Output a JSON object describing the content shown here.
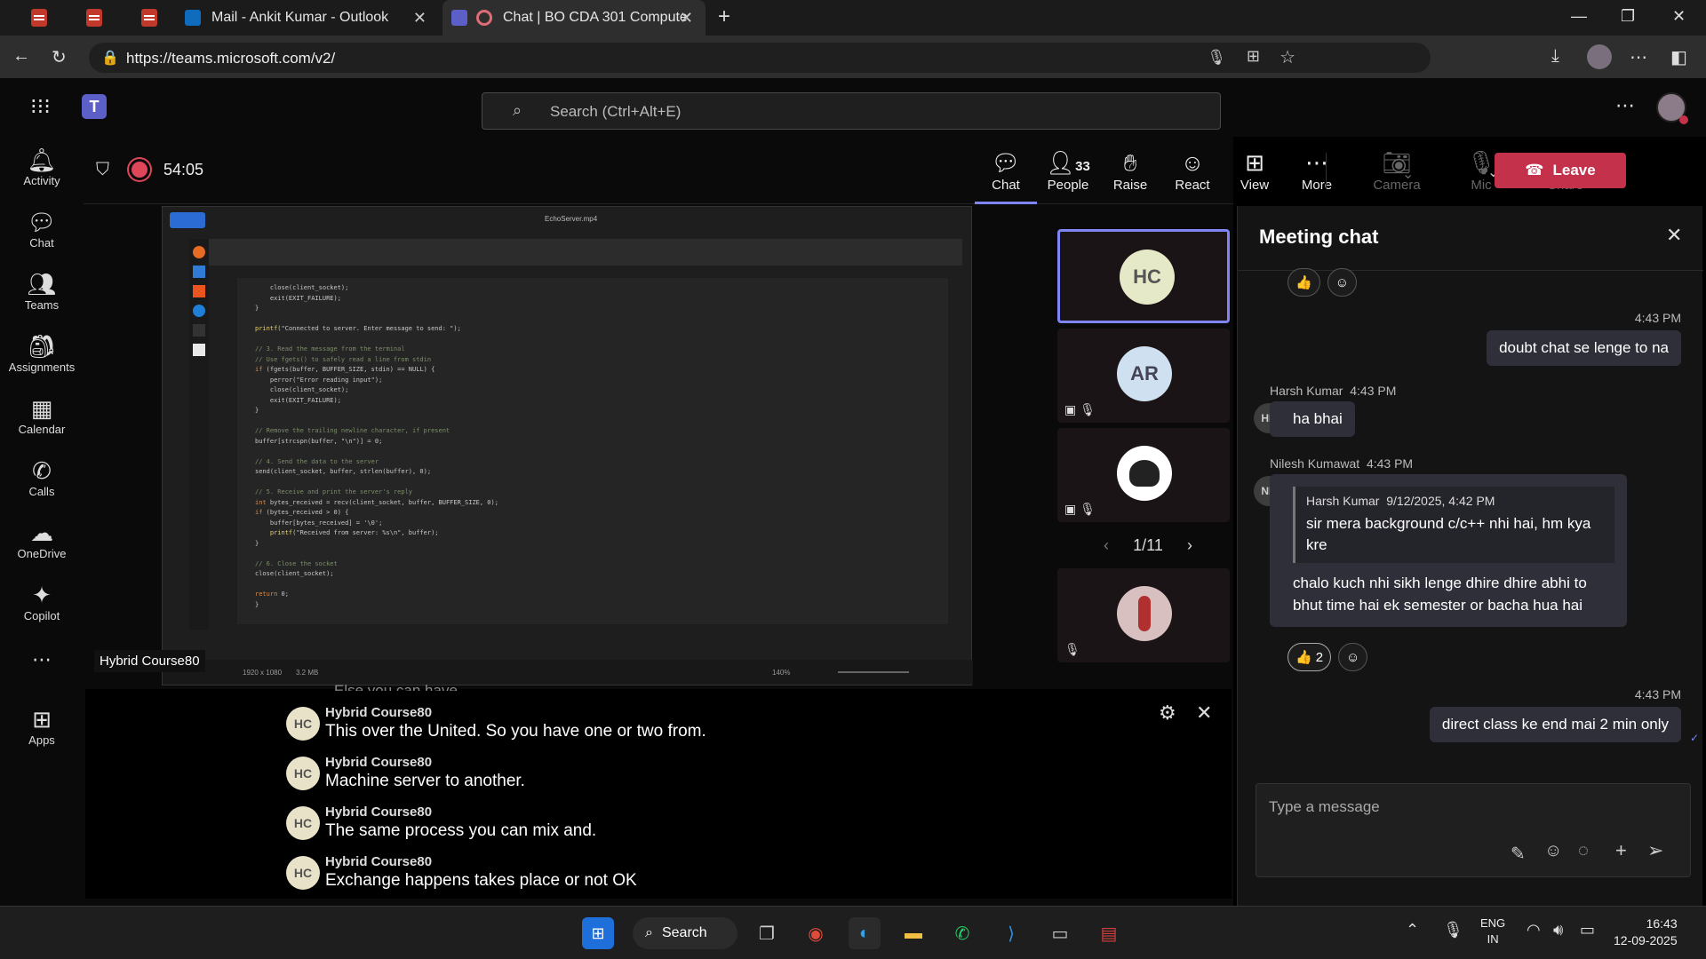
{
  "browser": {
    "tabs": [
      {
        "label": "Mail - Ankit Kumar - Outlook"
      },
      {
        "label": "Chat | BO CDA 301 Compute"
      }
    ],
    "url": "https://teams.microsoft.com/v2/"
  },
  "teams": {
    "search_placeholder": "Search (Ctrl+Alt+E)",
    "rail": [
      {
        "label": "Activity",
        "icon": "bell-icon"
      },
      {
        "label": "Chat",
        "icon": "chat-icon"
      },
      {
        "label": "Teams",
        "icon": "teams-icon"
      },
      {
        "label": "Assignments",
        "icon": "backpack-icon"
      },
      {
        "label": "Calendar",
        "icon": "calendar-icon"
      },
      {
        "label": "Calls",
        "icon": "phone-icon"
      },
      {
        "label": "OneDrive",
        "icon": "cloud-icon"
      },
      {
        "label": "Copilot",
        "icon": "copilot-icon"
      },
      {
        "label": "Apps",
        "icon": "apps-icon"
      }
    ]
  },
  "meeting": {
    "timer": "54:05",
    "controls": {
      "chat": "Chat",
      "people": "People",
      "people_count": "33",
      "raise": "Raise",
      "react": "React",
      "view": "View",
      "more": "More",
      "camera": "Camera",
      "mic": "Mic",
      "share": "Share",
      "leave": "Leave"
    },
    "shared_screen": {
      "filename": "EchoServer.mp4",
      "presenter_label": "Hybrid Course80",
      "zoom": "140%",
      "resolution": "1920 x 1080",
      "size": "3.2 MB"
    },
    "participants": [
      {
        "initials": "HC",
        "color": "#e6e9c8",
        "text_color": "#555"
      },
      {
        "initials": "AR",
        "color": "#cfe0f0",
        "text_color": "#445"
      },
      {
        "initials": "",
        "color": "#ffffff",
        "text_color": "#000"
      },
      {
        "initials": "",
        "color": "#d8c0c0",
        "text_color": "#000"
      }
    ],
    "pager": "1/11",
    "captions": [
      {
        "speaker": "Hybrid Course80",
        "initials": "HC",
        "text": "This over the United. So you have one or two from."
      },
      {
        "speaker": "Hybrid Course80",
        "initials": "HC",
        "text": "Machine server to another."
      },
      {
        "speaker": "Hybrid Course80",
        "initials": "HC",
        "text": "The same process you can mix and."
      },
      {
        "speaker": "Hybrid Course80",
        "initials": "HC",
        "text": "Exchange happens takes place or not OK"
      }
    ],
    "caption_partial": "Else you can have."
  },
  "chat": {
    "title": "Meeting chat",
    "messages": [
      {
        "time": "4:43 PM",
        "text": "doubt chat se lenge to na"
      },
      {
        "author": "Harsh Kumar",
        "initials": "HK",
        "time": "4:43 PM",
        "text": "ha bhai"
      },
      {
        "author": "Nilesh Kumawat",
        "initials": "NK",
        "time": "4:43 PM",
        "quote_author": "Harsh Kumar",
        "quote_time": "9/12/2025, 4:42 PM",
        "quote_text": "sir mera background c/c++ nhi hai, hm kya kre",
        "text": "chalo kuch nhi sikh lenge dhire dhire abhi to bhut time hai ek semester or bacha hua hai",
        "reaction_count": "2"
      },
      {
        "time": "4:43 PM",
        "text": "direct class ke end mai 2 min only"
      }
    ],
    "compose_placeholder": "Type a message"
  },
  "taskbar": {
    "search_label": "Search",
    "lang": "ENG",
    "region": "IN",
    "time": "16:43",
    "date": "12-09-2025"
  }
}
